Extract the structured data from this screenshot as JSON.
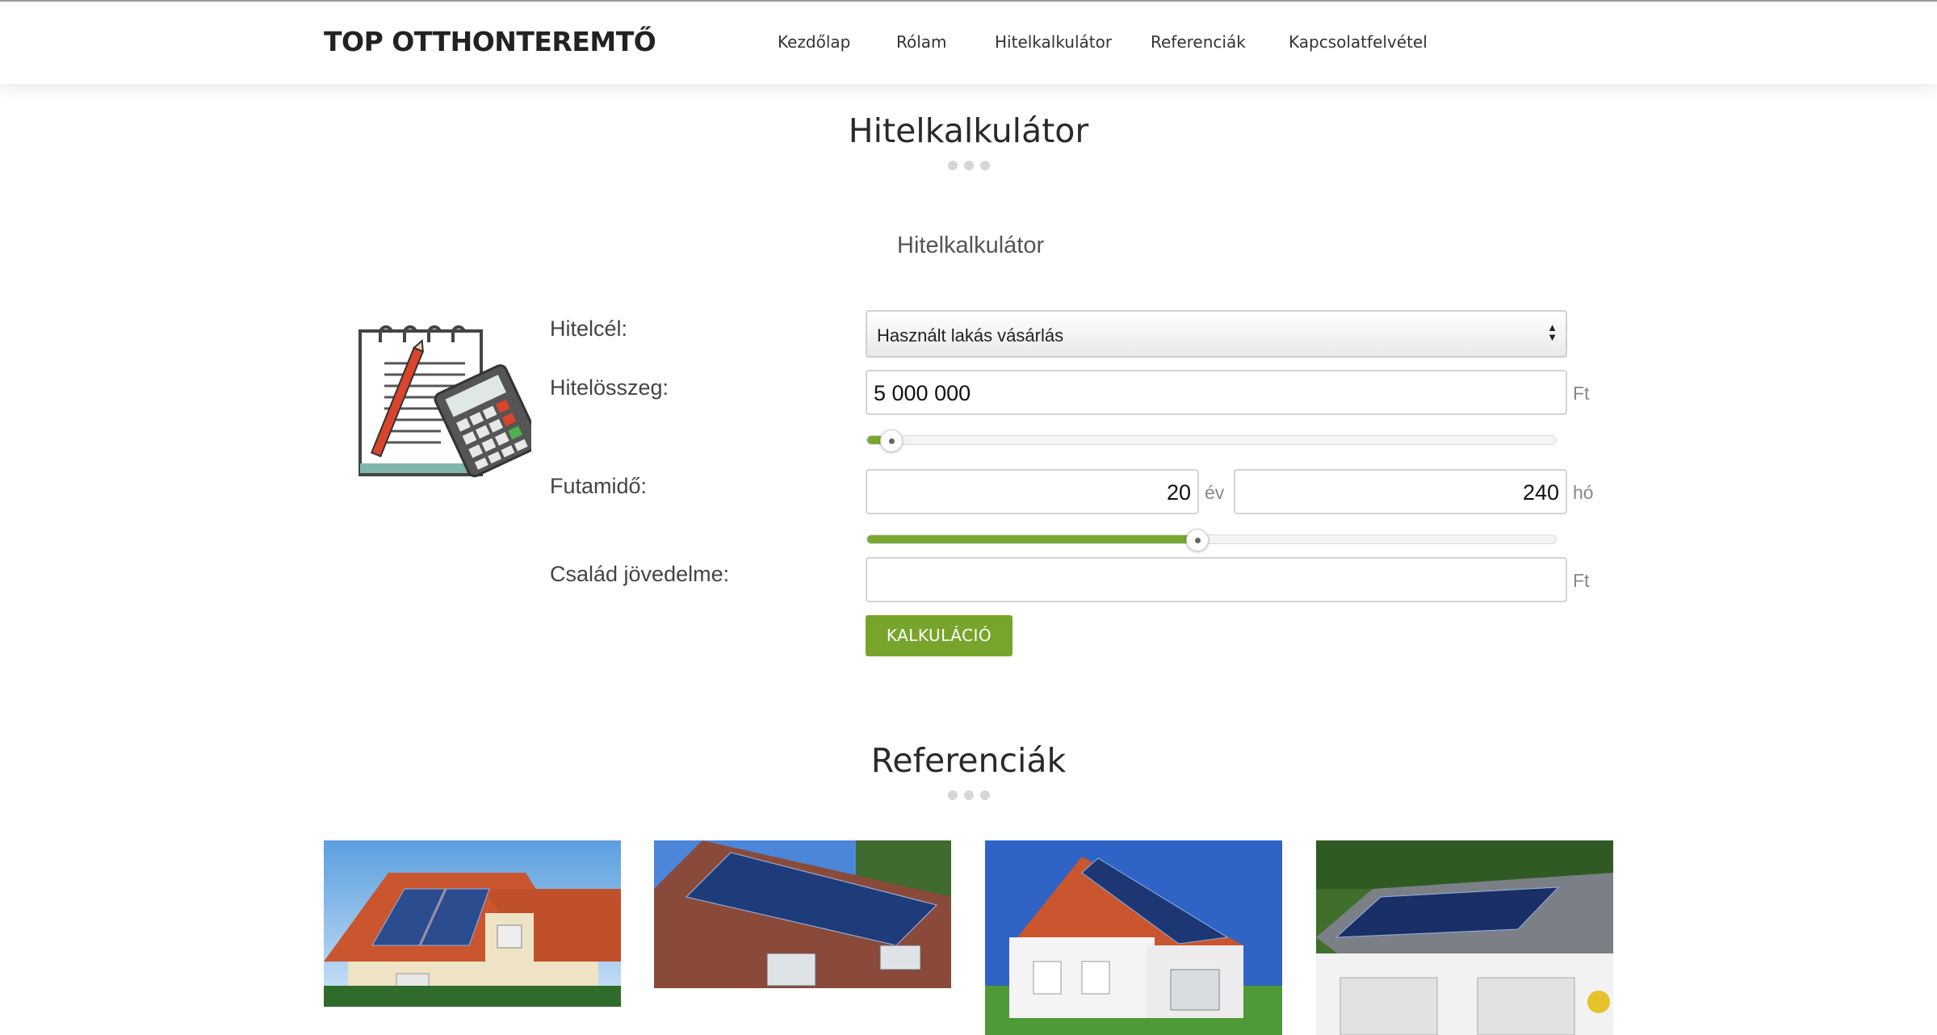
{
  "header": {
    "logo": "TOP OTTHONTEREMTŐ",
    "nav": [
      "Kezdőlap",
      "Rólam",
      "Hitelkalkulátor",
      "Referenciák",
      "Kapcsolatfelvétel"
    ]
  },
  "calculator_section": {
    "title": "Hitelkalkulátor",
    "subtitle": "Hitelkalkulátor",
    "icon": "notepad-calculator-icon",
    "labels": {
      "purpose": "Hitelcél:",
      "amount": "Hitelösszeg:",
      "term": "Futamidő:",
      "income": "Család jövedelme:"
    },
    "purpose_value": "Használt lakás vásárlás",
    "amount_value": "5 000 000",
    "amount_unit": "Ft",
    "amount_slider_fraction": 0.035,
    "term_years": "20",
    "term_years_unit": "év",
    "term_months": "240",
    "term_months_unit": "hó",
    "term_slider_fraction": 0.48,
    "income_value": "",
    "income_unit": "Ft",
    "button": "KALKULÁCIÓ"
  },
  "references_section": {
    "title": "Referenciák",
    "images": [
      "solar-roof-house-photo-1",
      "solar-roof-house-photo-2",
      "solar-roof-house-photo-3",
      "solar-roof-house-photo-4"
    ]
  },
  "colors": {
    "accent": "#77a52b",
    "text": "#333333",
    "dots": "#d6d6d6"
  }
}
